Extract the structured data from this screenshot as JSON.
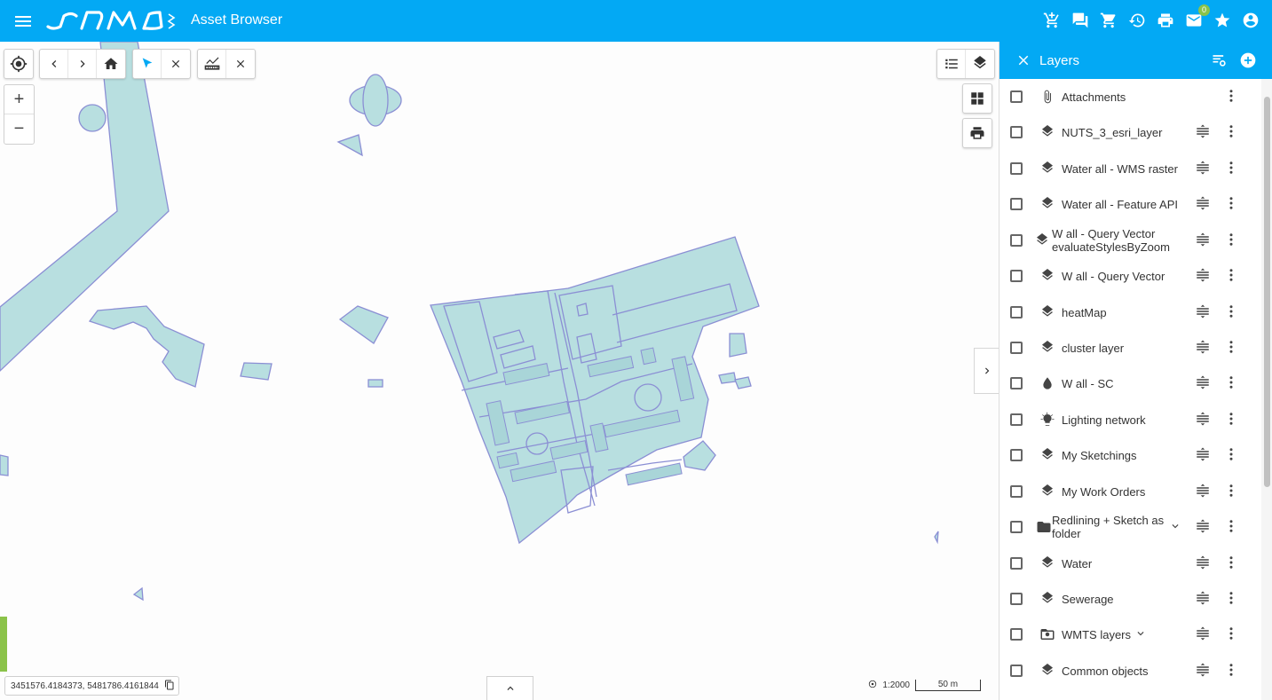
{
  "header": {
    "logo_text": "samo",
    "title": "Asset Browser",
    "notification_count": "0",
    "icons": [
      "add-to-cart-icon",
      "chat-icon",
      "cart-icon",
      "history-icon",
      "print-icon",
      "mail-icon",
      "star-icon",
      "account-icon"
    ]
  },
  "map": {
    "coordinates": "3451576.4184373, 5481786.4161844",
    "scale": "1:2000",
    "scalebar_label": "50 m",
    "feature_fill": "#b8dfe0",
    "feature_stroke": "#8b8fd4"
  },
  "panel": {
    "title": "Layers",
    "layers": [
      {
        "name": "Attachments",
        "icon": "attachment-icon"
      },
      {
        "name": "NUTS_3_esri_layer",
        "icon": "layers-icon"
      },
      {
        "name": "Water all - WMS raster",
        "icon": "layers-icon"
      },
      {
        "name": "Water all - Feature API",
        "icon": "layers-icon"
      },
      {
        "name": "W all - Query Vector evaluateStylesByZoom",
        "icon": "layers-icon"
      },
      {
        "name": "W all - Query Vector",
        "icon": "layers-icon"
      },
      {
        "name": "heatMap",
        "icon": "layers-icon"
      },
      {
        "name": "cluster layer",
        "icon": "layers-icon"
      },
      {
        "name": "W all - SC",
        "icon": "drop-icon"
      },
      {
        "name": "Lighting network",
        "icon": "bulb-icon"
      },
      {
        "name": "My Sketchings",
        "icon": "layers-icon"
      },
      {
        "name": "My Work Orders",
        "icon": "layers-icon"
      },
      {
        "name": "Redlining + Sketch as folder",
        "icon": "folder-icon"
      },
      {
        "name": "Water",
        "icon": "layers-icon"
      },
      {
        "name": "Sewerage",
        "icon": "layers-icon"
      },
      {
        "name": "WMTS layers",
        "icon": "folder-special-icon"
      },
      {
        "name": "Common objects",
        "icon": "layers-icon"
      }
    ]
  }
}
